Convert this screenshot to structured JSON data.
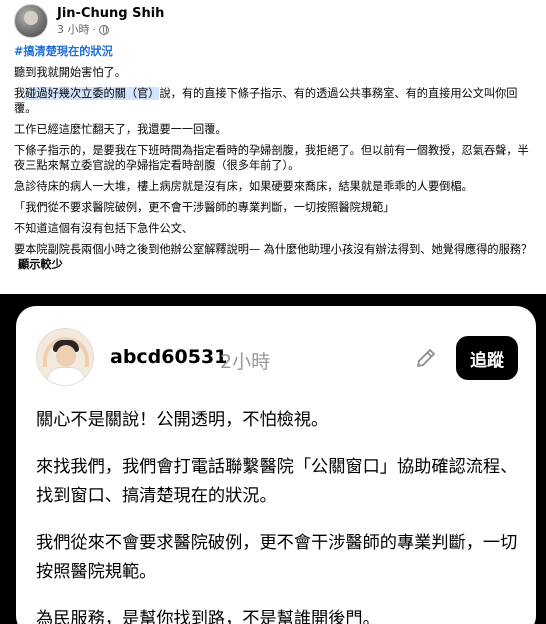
{
  "post": {
    "author": "Jin-Chung Shih",
    "time": "3 小時",
    "dot": "·",
    "hashtag": "#搞清楚現在的狀況",
    "p1": "聽到我就開始害怕了。",
    "p2_before": "我",
    "p2_highlight": "碰過好幾次立委的關（官）",
    "p2_after": "說，有的直接下條子指示、有的透過公共事務室、有的直接用公文叫你回覆。",
    "p3": "工作已經這麼忙翻天了，我還要一一回覆。",
    "p4": "下條子指示的，是要我在下班時間為指定看時的孕婦剖腹，我拒絕了。但以前有一個教授，忍氣吞聲，半夜三點來幫立委官說的孕婦指定看時剖腹（很多年前了）。",
    "p5": "急診待床的病人一大堆，樓上病房就是沒有床，如果硬要來喬床，結果就是乖乖的人要倒楣。",
    "p6": "「我們從不要求醫院破例，更不會干涉醫師的專業判斷，一切按照醫院規範」",
    "p7": "不知道這個有沒有包括下急件公文、",
    "p8": "要本院副院長兩個小時之後到他辦公室解釋說明— 為什麼他助理小孩沒有辦法得到、她覺得應得的服務？",
    "see_more": "顯示較少"
  },
  "threads": {
    "username": "abcd60531",
    "time": "2小時",
    "follow_label": "追蹤",
    "lines": [
      "關心不是關說！公開透明，不怕檢視。",
      "來找我們，我們會打電話聯繫醫院「公關窗口」協助確認流程、找到窗口、搞清楚現在的狀況。",
      "我們從來不會要求醫院破例，更不會干涉醫師的專業判斷，一切按照醫院規範。",
      "為民服務，是幫你找到路，不是幫誰開後門。"
    ]
  },
  "icons": {
    "globe": "globe-icon",
    "edit": "pencil-icon",
    "avatar": "avatar"
  },
  "colors": {
    "hashtag": "#216fdb",
    "highlight": "#d3e4fd",
    "meta_gray": "#65676b",
    "threads_bg": "#000000",
    "follow_button": "#000000"
  }
}
